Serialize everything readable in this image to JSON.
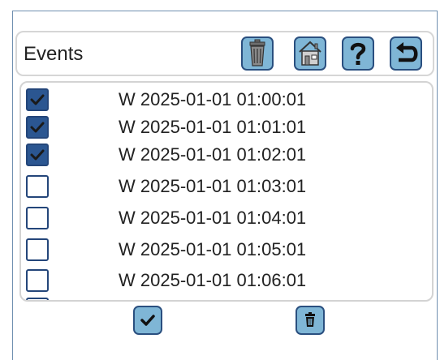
{
  "header": {
    "title": "Events"
  },
  "icons": {
    "delete": "trash-icon",
    "home": "home-icon",
    "help": "question-mark-icon",
    "back": "back-arrow-icon",
    "select_all": "checkmark-icon",
    "delete_selected": "trash-icon"
  },
  "events": [
    {
      "text": "W 2025-01-01 01:00:01",
      "checked": true
    },
    {
      "text": "W 2025-01-01 01:01:01",
      "checked": true
    },
    {
      "text": "W 2025-01-01 01:02:01",
      "checked": true
    },
    {
      "text": "W 2025-01-01 01:03:01",
      "checked": false
    },
    {
      "text": "W 2025-01-01 01:04:01",
      "checked": false
    },
    {
      "text": "W 2025-01-01 01:05:01",
      "checked": false
    },
    {
      "text": "W 2025-01-01 01:06:01",
      "checked": false
    }
  ],
  "colors": {
    "button_fill": "#7fb6d6",
    "button_border": "#2a4f7f",
    "checkbox_checked": "#2b5691"
  }
}
